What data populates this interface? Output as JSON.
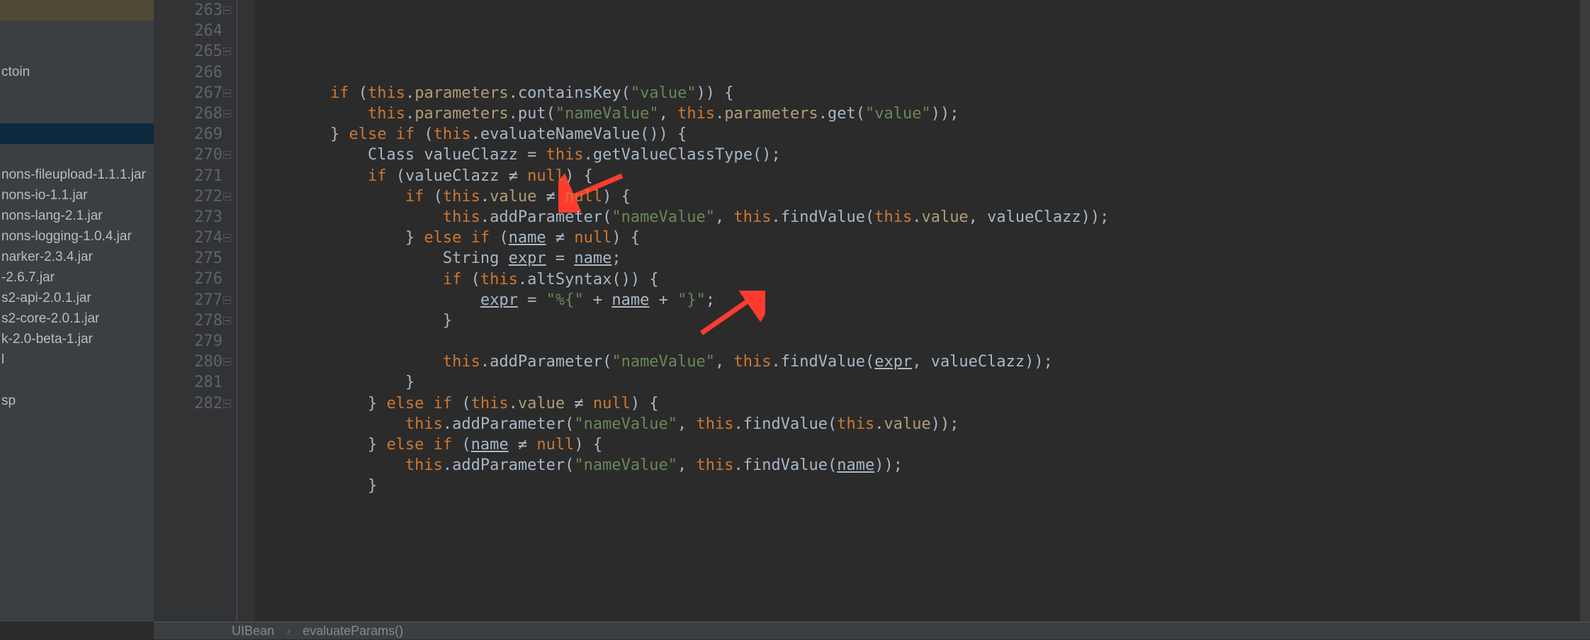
{
  "sidebar": {
    "rows": [
      {
        "label": "",
        "cls": "sel-yellow"
      },
      {
        "label": ""
      },
      {
        "label": ""
      },
      {
        "label": "ctoin"
      },
      {
        "label": ""
      },
      {
        "label": ""
      },
      {
        "label": "",
        "cls": "sel-blue"
      },
      {
        "label": ""
      },
      {
        "label": "nons-fileupload-1.1.1.jar"
      },
      {
        "label": "nons-io-1.1.jar"
      },
      {
        "label": "nons-lang-2.1.jar"
      },
      {
        "label": "nons-logging-1.0.4.jar"
      },
      {
        "label": "narker-2.3.4.jar"
      },
      {
        "label": "-2.6.7.jar"
      },
      {
        "label": "s2-api-2.0.1.jar"
      },
      {
        "label": "s2-core-2.0.1.jar"
      },
      {
        "label": "k-2.0-beta-1.jar"
      },
      {
        "label": "l"
      },
      {
        "label": ""
      },
      {
        "label": "sp"
      }
    ]
  },
  "gutter": {
    "start": 263,
    "end": 282,
    "fold_marks": [
      263,
      265,
      267,
      268,
      270,
      272,
      274,
      277,
      278,
      280,
      282
    ]
  },
  "code": {
    "lines": [
      [
        {
          "t": "        ",
          "c": "p"
        },
        {
          "t": "if ",
          "c": "k"
        },
        {
          "t": "(",
          "c": "p"
        },
        {
          "t": "this",
          "c": "k"
        },
        {
          "t": ".",
          "c": "p"
        },
        {
          "t": "parameters",
          "c": "f"
        },
        {
          "t": ".containsKey(",
          "c": "p"
        },
        {
          "t": "\"value\"",
          "c": "s"
        },
        {
          "t": ")) {",
          "c": "p"
        }
      ],
      [
        {
          "t": "            ",
          "c": "p"
        },
        {
          "t": "this",
          "c": "k"
        },
        {
          "t": ".",
          "c": "p"
        },
        {
          "t": "parameters",
          "c": "f"
        },
        {
          "t": ".put(",
          "c": "p"
        },
        {
          "t": "\"nameValue\"",
          "c": "s"
        },
        {
          "t": ", ",
          "c": "p"
        },
        {
          "t": "this",
          "c": "k"
        },
        {
          "t": ".",
          "c": "p"
        },
        {
          "t": "parameters",
          "c": "f"
        },
        {
          "t": ".get(",
          "c": "p"
        },
        {
          "t": "\"value\"",
          "c": "s"
        },
        {
          "t": "));",
          "c": "p"
        }
      ],
      [
        {
          "t": "        } ",
          "c": "p"
        },
        {
          "t": "else if ",
          "c": "k"
        },
        {
          "t": "(",
          "c": "p"
        },
        {
          "t": "this",
          "c": "k"
        },
        {
          "t": ".evaluateNameValue()) {",
          "c": "p"
        }
      ],
      [
        {
          "t": "            Class valueClazz = ",
          "c": "p"
        },
        {
          "t": "this",
          "c": "k"
        },
        {
          "t": ".getValueClassType();",
          "c": "p"
        }
      ],
      [
        {
          "t": "            ",
          "c": "p"
        },
        {
          "t": "if ",
          "c": "k"
        },
        {
          "t": "(valueClazz ≠ ",
          "c": "p"
        },
        {
          "t": "null",
          "c": "k"
        },
        {
          "t": ") {",
          "c": "p"
        }
      ],
      [
        {
          "t": "                ",
          "c": "p"
        },
        {
          "t": "if ",
          "c": "k"
        },
        {
          "t": "(",
          "c": "p"
        },
        {
          "t": "this",
          "c": "k"
        },
        {
          "t": ".",
          "c": "p"
        },
        {
          "t": "value",
          "c": "f"
        },
        {
          "t": " ≠ ",
          "c": "p"
        },
        {
          "t": "null",
          "c": "k"
        },
        {
          "t": ") {",
          "c": "p"
        }
      ],
      [
        {
          "t": "                    ",
          "c": "p"
        },
        {
          "t": "this",
          "c": "k"
        },
        {
          "t": ".addParameter(",
          "c": "p"
        },
        {
          "t": "\"nameValue\"",
          "c": "s"
        },
        {
          "t": ", ",
          "c": "p"
        },
        {
          "t": "this",
          "c": "k"
        },
        {
          "t": ".findValue(",
          "c": "p"
        },
        {
          "t": "this",
          "c": "k"
        },
        {
          "t": ".",
          "c": "p"
        },
        {
          "t": "value",
          "c": "f"
        },
        {
          "t": ", valueClazz));",
          "c": "p"
        }
      ],
      [
        {
          "t": "                } ",
          "c": "p"
        },
        {
          "t": "else if ",
          "c": "k"
        },
        {
          "t": "(",
          "c": "p"
        },
        {
          "t": "name",
          "c": "p u"
        },
        {
          "t": " ≠ ",
          "c": "p"
        },
        {
          "t": "null",
          "c": "k"
        },
        {
          "t": ") {",
          "c": "p"
        }
      ],
      [
        {
          "t": "                    String ",
          "c": "p"
        },
        {
          "t": "expr",
          "c": "p u"
        },
        {
          "t": " = ",
          "c": "p"
        },
        {
          "t": "name",
          "c": "p u"
        },
        {
          "t": ";",
          "c": "p"
        }
      ],
      [
        {
          "t": "                    ",
          "c": "p"
        },
        {
          "t": "if ",
          "c": "k"
        },
        {
          "t": "(",
          "c": "p"
        },
        {
          "t": "this",
          "c": "k"
        },
        {
          "t": ".altSyntax()) {",
          "c": "p"
        }
      ],
      [
        {
          "t": "                        ",
          "c": "p"
        },
        {
          "t": "expr",
          "c": "p u"
        },
        {
          "t": " = ",
          "c": "p"
        },
        {
          "t": "\"%{\"",
          "c": "s"
        },
        {
          "t": " + ",
          "c": "p"
        },
        {
          "t": "name",
          "c": "p u"
        },
        {
          "t": " + ",
          "c": "p"
        },
        {
          "t": "\"}\"",
          "c": "s"
        },
        {
          "t": ";",
          "c": "p"
        }
      ],
      [
        {
          "t": "                    }",
          "c": "p"
        }
      ],
      [
        {
          "t": "",
          "c": "p"
        }
      ],
      [
        {
          "t": "                    ",
          "c": "p"
        },
        {
          "t": "this",
          "c": "k"
        },
        {
          "t": ".addParameter(",
          "c": "p"
        },
        {
          "t": "\"nameValue\"",
          "c": "s"
        },
        {
          "t": ", ",
          "c": "p"
        },
        {
          "t": "this",
          "c": "k"
        },
        {
          "t": ".findValue(",
          "c": "p"
        },
        {
          "t": "expr",
          "c": "p u"
        },
        {
          "t": ", valueClazz));",
          "c": "p"
        }
      ],
      [
        {
          "t": "                }",
          "c": "p"
        }
      ],
      [
        {
          "t": "            } ",
          "c": "p"
        },
        {
          "t": "else if ",
          "c": "k"
        },
        {
          "t": "(",
          "c": "p"
        },
        {
          "t": "this",
          "c": "k"
        },
        {
          "t": ".",
          "c": "p"
        },
        {
          "t": "value",
          "c": "f"
        },
        {
          "t": " ≠ ",
          "c": "p"
        },
        {
          "t": "null",
          "c": "k"
        },
        {
          "t": ") {",
          "c": "p"
        }
      ],
      [
        {
          "t": "                ",
          "c": "p"
        },
        {
          "t": "this",
          "c": "k"
        },
        {
          "t": ".addParameter(",
          "c": "p"
        },
        {
          "t": "\"nameValue\"",
          "c": "s"
        },
        {
          "t": ", ",
          "c": "p"
        },
        {
          "t": "this",
          "c": "k"
        },
        {
          "t": ".findValue(",
          "c": "p"
        },
        {
          "t": "this",
          "c": "k"
        },
        {
          "t": ".",
          "c": "p"
        },
        {
          "t": "value",
          "c": "f"
        },
        {
          "t": "));",
          "c": "p"
        }
      ],
      [
        {
          "t": "            } ",
          "c": "p"
        },
        {
          "t": "else if ",
          "c": "k"
        },
        {
          "t": "(",
          "c": "p"
        },
        {
          "t": "name",
          "c": "p u"
        },
        {
          "t": " ≠ ",
          "c": "p"
        },
        {
          "t": "null",
          "c": "k"
        },
        {
          "t": ") {",
          "c": "p"
        }
      ],
      [
        {
          "t": "                ",
          "c": "p"
        },
        {
          "t": "this",
          "c": "k"
        },
        {
          "t": ".addParameter(",
          "c": "p"
        },
        {
          "t": "\"nameValue\"",
          "c": "s"
        },
        {
          "t": ", ",
          "c": "p"
        },
        {
          "t": "this",
          "c": "k"
        },
        {
          "t": ".findValue(",
          "c": "p"
        },
        {
          "t": "name",
          "c": "p u"
        },
        {
          "t": "));",
          "c": "p"
        }
      ],
      [
        {
          "t": "            }",
          "c": "p"
        }
      ]
    ]
  },
  "breadcrumbs": {
    "items": [
      "UIBean",
      "evaluateParams()"
    ]
  }
}
